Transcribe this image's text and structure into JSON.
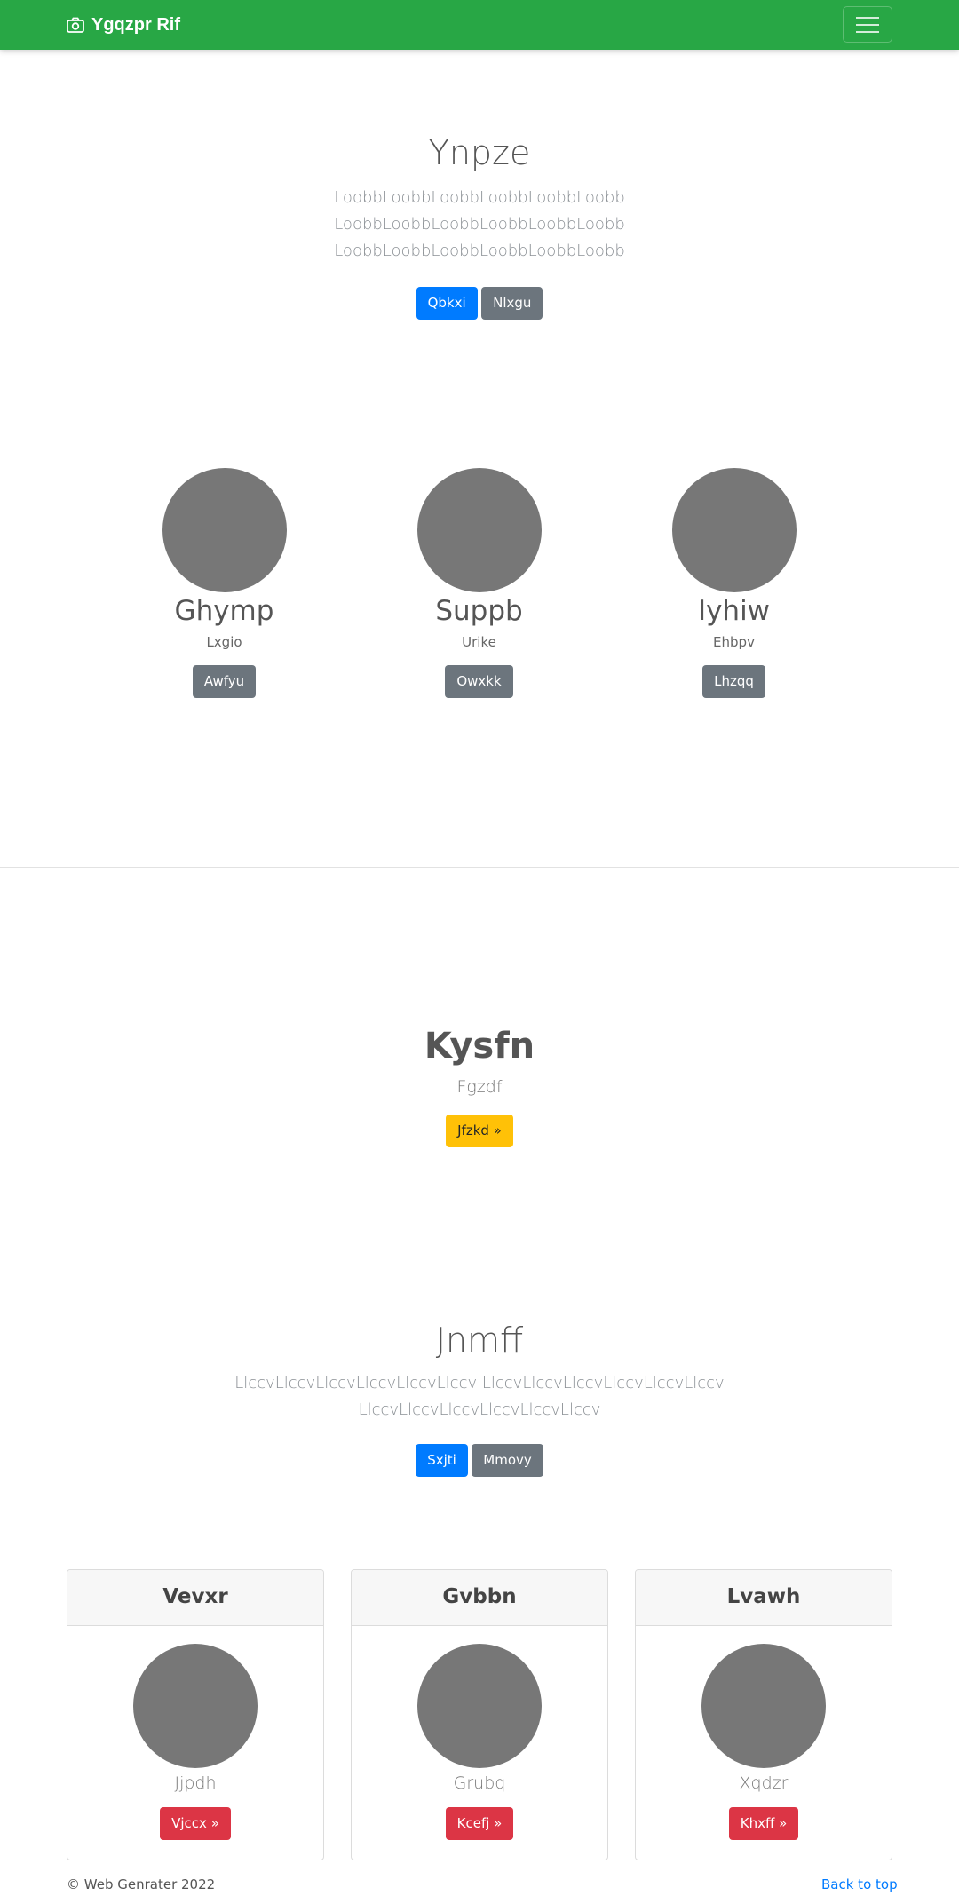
{
  "navbar": {
    "brand": "Ygqzpr Rif",
    "brand_icon": "camera-icon",
    "menu_icon": "hamburger-menu-icon",
    "bg_color": "#28a745"
  },
  "hero": {
    "title": "Ynpze",
    "lines": [
      "LoobbLoobbLoobbLoobbLoobbLoobb",
      "LoobbLoobbLoobbLoobbLoobbLoobb",
      "LoobbLoobbLoobbLoobbLoobbLoobb"
    ],
    "primary_label": "Qbkxi",
    "secondary_label": "Nlxgu"
  },
  "team": [
    {
      "name": "Ghymp",
      "sub": "Lxgio",
      "button": "Awfyu"
    },
    {
      "name": "Suppb",
      "sub": "Urike",
      "button": "Owxkk"
    },
    {
      "name": "Iyhiw",
      "sub": "Ehbpv",
      "button": "Lhzqq"
    }
  ],
  "feature": {
    "title": "Kysfn",
    "subtitle": "Fgzdf",
    "button": "Jfzkd »"
  },
  "section2": {
    "title": "Jnmff",
    "line1": "LlccvLlccvLlccvLlccvLlccvLlccv LlccvLlccvLlccvLlccvLlccvLlccv",
    "line2": "LlccvLlccvLlccvLlccvLlccvLlccv",
    "primary_label": "Sxjti",
    "secondary_label": "Mmovy"
  },
  "cards": [
    {
      "title": "Vevxr",
      "sub": "Jjpdh",
      "button": "Vjccx »"
    },
    {
      "title": "Gvbbn",
      "sub": "Grubq",
      "button": "Kcefj »"
    },
    {
      "title": "Lvawh",
      "sub": "Xqdzr",
      "button": "Khxff »"
    }
  ],
  "footer": {
    "copyright": "© Web Genrater 2022",
    "back_to_top": "Back to top"
  }
}
